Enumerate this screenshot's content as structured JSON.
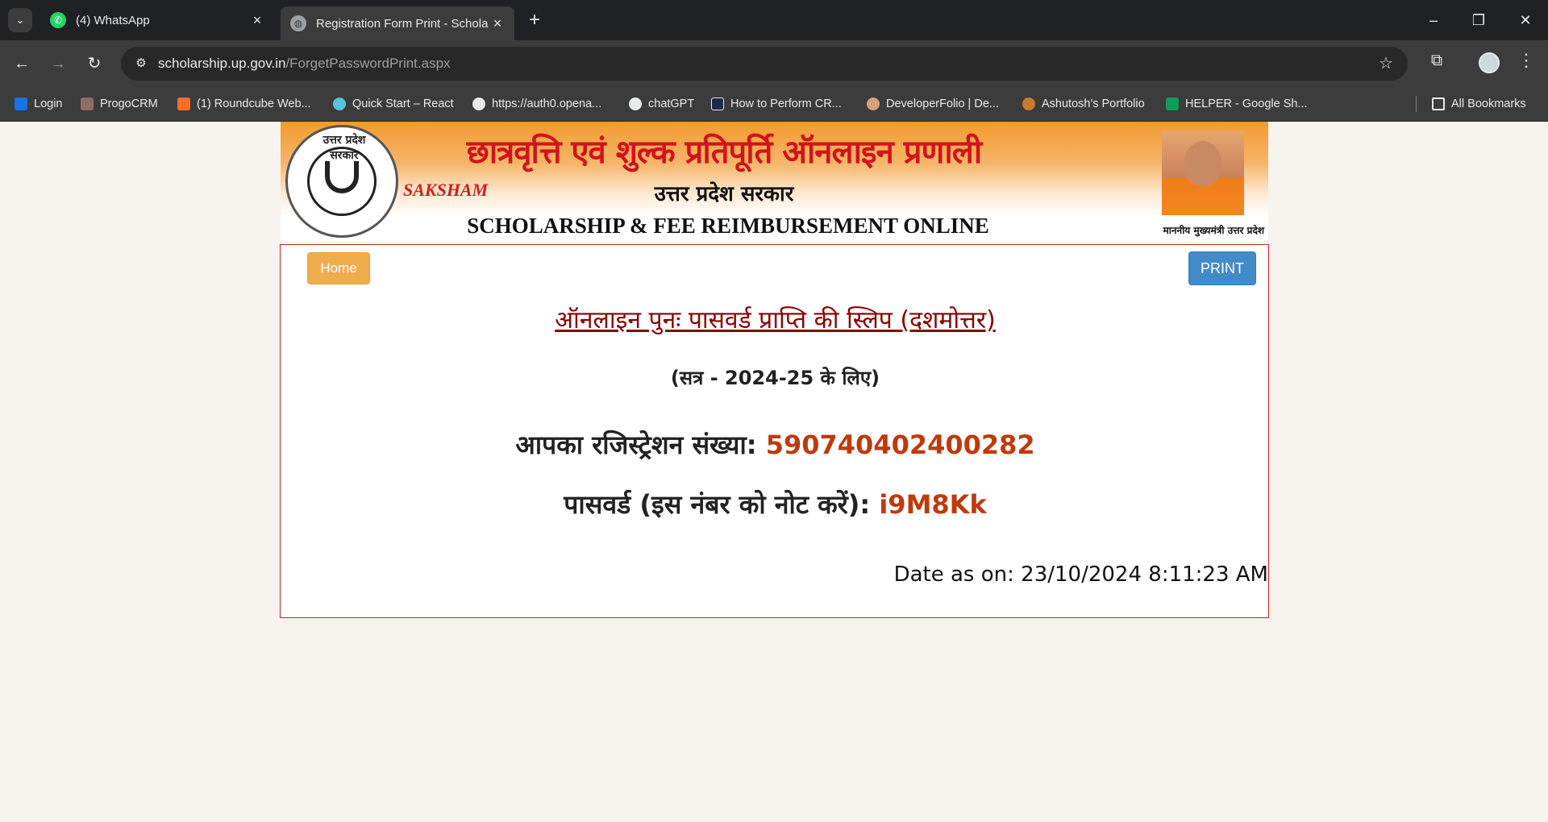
{
  "browser": {
    "tabs": [
      {
        "title": "(4) WhatsApp",
        "favicon": "whatsapp-icon",
        "active": false
      },
      {
        "title": "Registration Form Print - Schola",
        "favicon": "globe-icon",
        "active": true
      }
    ],
    "address": {
      "host": "scholarship.up.gov.in",
      "path": "/ForgetPasswordPrint.aspx"
    },
    "bookmarks": [
      {
        "label": "Login",
        "icon": "login-icon",
        "color": "#1a73e8"
      },
      {
        "label": "ProgoCRM",
        "icon": "progocrm-icon",
        "color": "#8d6e63"
      },
      {
        "label": "(1) Roundcube Web...",
        "icon": "cpanel-icon",
        "color": "#ff6c2c"
      },
      {
        "label": "Quick Start – React",
        "icon": "react-icon",
        "color": "#58c4dc"
      },
      {
        "label": "https://auth0.opena...",
        "icon": "openai-icon",
        "color": "#e8eaed"
      },
      {
        "label": "chatGPT",
        "icon": "openai-icon",
        "color": "#e8eaed"
      },
      {
        "label": "How to Perform CR...",
        "icon": "appwrite-icon",
        "color": "#1e2a4a"
      },
      {
        "label": "DeveloperFolio | De...",
        "icon": "avatar-icon",
        "color": "#d7a27a"
      },
      {
        "label": "Ashutosh's Portfolio",
        "icon": "portfolio-icon",
        "color": "#c77b30"
      },
      {
        "label": "HELPER - Google Sh...",
        "icon": "sheets-icon",
        "color": "#0f9d58"
      }
    ],
    "all_bookmarks": "All Bookmarks"
  },
  "banner": {
    "hindi_title": "छात्रवृत्ति एवं शुल्क प्रतिपूर्ति ऑनलाइन प्रणाली",
    "state": "उत्तर प्रदेश सरकार",
    "saksham": "SAKSHAM",
    "english_title": "SCHOLARSHIP & FEE REIMBURSEMENT ONLINE SYSTEM",
    "emblem_text": "उत्तर प्रदेश सरकार",
    "cm_caption": "माननीय मुख्यमंत्री उत्तर प्रदेश"
  },
  "slip": {
    "home_label": "Home",
    "print_label": "PRINT",
    "title": "ऑनलाइन पुनः पासवर्ड प्राप्ति की स्लिप (दशमोत्तर)",
    "session": "(सत्र - 2024-25 के लिए)",
    "reg_label": "आपका रजिस्ट्रेशन संख्या:",
    "reg_number": "590740402400282",
    "pw_label": "पासवर्ड (इस नंबर को नोट करें):",
    "password": "i9M8Kk",
    "date_label": "Date as on:",
    "date_value": "23/10/2024 8:11:23 AM"
  },
  "colors": {
    "highlight": "#c0390b",
    "title": "#8b0000",
    "border": "#c0272d",
    "home_button": "#f0ad4e",
    "print_button": "#428bca"
  }
}
